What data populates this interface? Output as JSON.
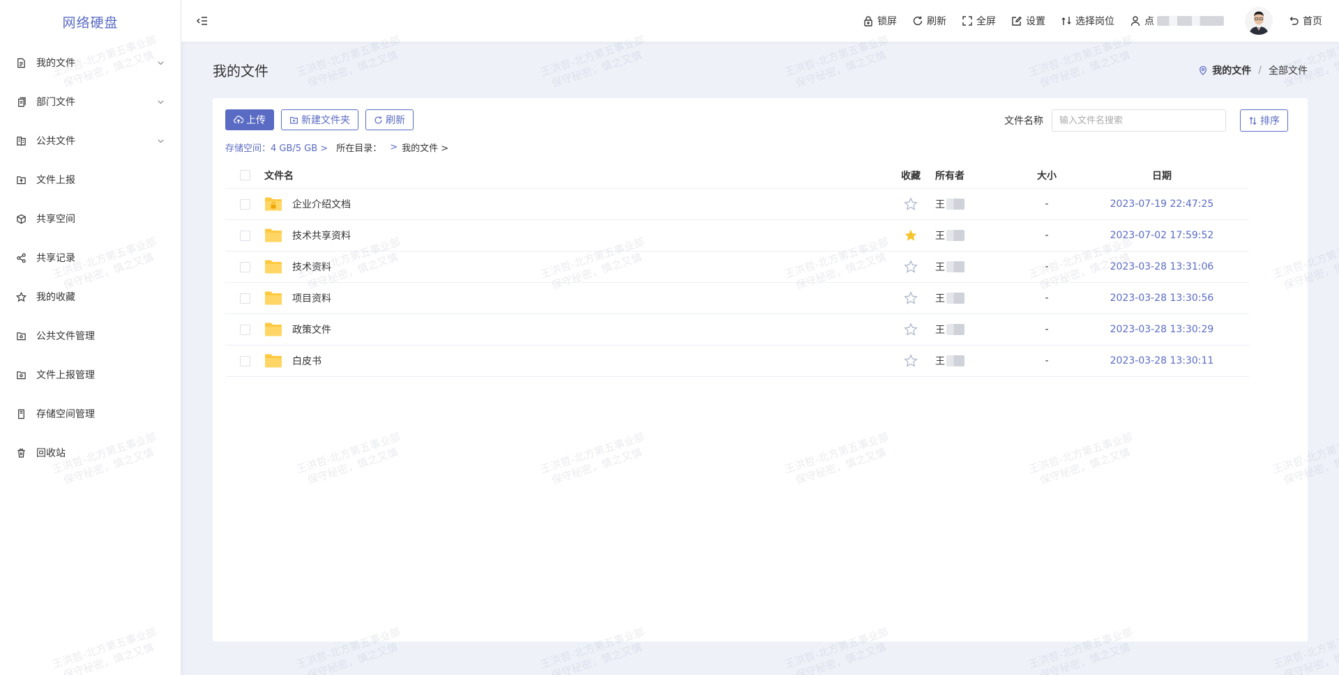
{
  "app": {
    "title": "网络硬盘"
  },
  "sidebar": {
    "items": [
      {
        "label": "我的文件",
        "icon": "document-icon",
        "has_children": true
      },
      {
        "label": "部门文件",
        "icon": "documents-icon",
        "has_children": true
      },
      {
        "label": "公共文件",
        "icon": "public-docs-icon",
        "has_children": true
      },
      {
        "label": "文件上报",
        "icon": "upload-report-icon",
        "has_children": false
      },
      {
        "label": "共享空间",
        "icon": "cube-icon",
        "has_children": false
      },
      {
        "label": "共享记录",
        "icon": "share-icon",
        "has_children": false
      },
      {
        "label": "我的收藏",
        "icon": "star-icon",
        "has_children": false
      },
      {
        "label": "公共文件管理",
        "icon": "folder-settings-icon",
        "has_children": false
      },
      {
        "label": "文件上报管理",
        "icon": "folder-settings-icon",
        "has_children": false
      },
      {
        "label": "存储空间管理",
        "icon": "storage-icon",
        "has_children": false
      },
      {
        "label": "回收站",
        "icon": "trash-icon",
        "has_children": false
      }
    ]
  },
  "header": {
    "lock": "锁屏",
    "refresh": "刷新",
    "fullscreen": "全屏",
    "settings": "设置",
    "select_post": "选择岗位",
    "user_initial": "点",
    "home": "首页"
  },
  "page": {
    "title": "我的文件",
    "breadcrumb": {
      "current": "我的文件",
      "separator": "/",
      "item": "全部文件"
    }
  },
  "toolbar": {
    "upload": "上传",
    "new_folder": "新建文件夹",
    "refresh": "刷新",
    "search_label": "文件名称",
    "search_placeholder": "输入文件名搜索",
    "sort": "排序"
  },
  "path": {
    "storage": "存储空间：4 GB/5 GB  >",
    "dir_label": "所在目录：",
    "dir_link": ">",
    "dir_current": "我的文件  >"
  },
  "table": {
    "columns": {
      "name": "文件名",
      "fav": "收藏",
      "owner": "所有者",
      "size": "大小",
      "date": "日期"
    },
    "rows": [
      {
        "name": "企业介绍文档",
        "starred": false,
        "locked": true,
        "owner": "王",
        "size": "-",
        "date": "2023-07-19 22:47:25"
      },
      {
        "name": "技术共享资料",
        "starred": true,
        "locked": false,
        "owner": "王",
        "size": "-",
        "date": "2023-07-02 17:59:52"
      },
      {
        "name": "技术资料",
        "starred": false,
        "locked": false,
        "owner": "王",
        "size": "-",
        "date": "2023-03-28 13:31:06"
      },
      {
        "name": "项目资料",
        "starred": false,
        "locked": false,
        "owner": "王",
        "size": "-",
        "date": "2023-03-28 13:30:56"
      },
      {
        "name": "政策文件",
        "starred": false,
        "locked": false,
        "owner": "王",
        "size": "-",
        "date": "2023-03-28 13:30:29"
      },
      {
        "name": "白皮书",
        "starred": false,
        "locked": false,
        "owner": "王",
        "size": "-",
        "date": "2023-03-28 13:30:11"
      }
    ]
  },
  "watermark": {
    "line1": "王洪哲-北方第五事业部",
    "line2": "保守秘密，慎之又慎"
  },
  "colors": {
    "accent": "#5a6bc4",
    "folder": "#ffc940",
    "star": "#f5c32a"
  }
}
